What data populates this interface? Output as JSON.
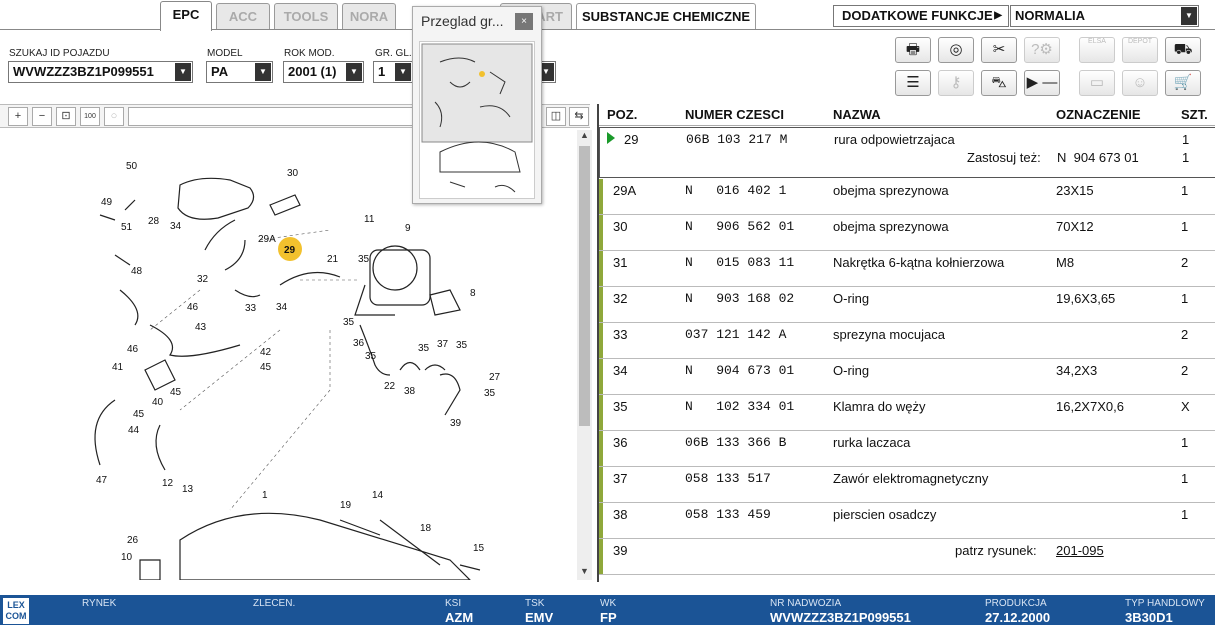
{
  "tabs": [
    {
      "label": "EPC",
      "state": "active"
    },
    {
      "label": "ACC",
      "state": "disabled"
    },
    {
      "label": "TOOLS",
      "state": "disabled"
    },
    {
      "label": "NORA",
      "state": "disabled"
    },
    {
      "label": "ART",
      "state": "disabled"
    },
    {
      "label": "SUBSTANCJE CHEMICZNE",
      "state": "enabled"
    }
  ],
  "functions": {
    "label": "DODATKOWE FUNKCJE",
    "arrow": "▶",
    "selected": "NORMALIA"
  },
  "vehicle": {
    "vin_label": "SZUKAJ ID POJAZDU",
    "vin_value": "WVWZZZ3BZ1P099551",
    "model_label": "MODEL",
    "model_value": "PA",
    "year_label": "ROK MOD.",
    "year_value": "2001 (1)",
    "group_label": "GR. GL.",
    "group_value": "1"
  },
  "overview": {
    "title": "Przeglad gr...",
    "close": "×"
  },
  "toolbar_icons": [
    {
      "name": "print-icon",
      "glyph": "🖶",
      "disabled": false
    },
    {
      "name": "settings-disc-icon",
      "glyph": "◎",
      "disabled": false
    },
    {
      "name": "tools-icon",
      "glyph": "✂",
      "disabled": false
    },
    {
      "name": "search-parts-icon",
      "glyph": "?⚙",
      "disabled": true
    },
    {
      "name": "elsa-icon",
      "glyph": "▭",
      "caption": "ELSA",
      "disabled": true
    },
    {
      "name": "depot-icon",
      "glyph": "▭",
      "caption": "DEPOT",
      "disabled": true
    },
    {
      "name": "cart-transfer-icon",
      "glyph": "⛟",
      "disabled": false
    },
    {
      "name": "list-icon",
      "glyph": "☰",
      "disabled": false
    },
    {
      "name": "key-icon",
      "glyph": "⚷",
      "disabled": true
    },
    {
      "name": "vehicle-lift-icon",
      "glyph": "⛍",
      "disabled": false
    },
    {
      "name": "play-minus-icon",
      "glyph": "▶ —",
      "disabled": false
    },
    {
      "name": "copy-icon",
      "glyph": "▭",
      "disabled": true
    },
    {
      "name": "user-icon",
      "glyph": "☺",
      "disabled": true
    },
    {
      "name": "cart-icon",
      "glyph": "🛒",
      "disabled": false
    }
  ],
  "zoom": [
    {
      "name": "zoom-in-icon",
      "glyph": "+"
    },
    {
      "name": "zoom-out-icon",
      "glyph": "−"
    },
    {
      "name": "zoom-fit-icon",
      "glyph": "⊡"
    },
    {
      "name": "zoom-100-icon",
      "glyph": "100"
    },
    {
      "name": "zoom-area-icon",
      "glyph": "○"
    }
  ],
  "columns": {
    "pos": "POZ.",
    "part": "NUMER CZESCI",
    "name": "NAZWA",
    "code": "OZNACZENIE",
    "qty": "SZT."
  },
  "rows": [
    {
      "pos": "29",
      "part": "06B 103 217 M",
      "name": "rura odpowietrzajaca",
      "code": "",
      "qty": "1",
      "selected": true,
      "note_label": "Zastosuj też:",
      "note_part": "N  904 673 01",
      "note_qty": "1"
    },
    {
      "pos": "29A",
      "part": "N   016 402 1",
      "name": "obejma sprezynowa",
      "code": "23X15",
      "qty": "1"
    },
    {
      "pos": "30",
      "part": "N   906 562 01",
      "name": "obejma sprezynowa",
      "code": "70X12",
      "qty": "1"
    },
    {
      "pos": "31",
      "part": "N   015 083 11",
      "name": "Nakrętka 6-kątna kołnierzowa",
      "code": "M8",
      "qty": "2"
    },
    {
      "pos": "32",
      "part": "N   903 168 02",
      "name": "O-ring",
      "code": "19,6X3,65",
      "qty": "1"
    },
    {
      "pos": "33",
      "part": "037 121 142 A",
      "name": "sprezyna mocujaca",
      "code": "",
      "qty": "2"
    },
    {
      "pos": "34",
      "part": "N   904 673 01",
      "name": "O-ring",
      "code": "34,2X3",
      "qty": "2"
    },
    {
      "pos": "35",
      "part": "N   102 334 01",
      "name": "Klamra do węży",
      "code": "16,2X7X0,6",
      "qty": "X"
    },
    {
      "pos": "36",
      "part": "06B 133 366 B",
      "name": "rurka laczaca",
      "code": "",
      "qty": "1"
    },
    {
      "pos": "37",
      "part": "058 133 517",
      "name": "Zawór elektromagnetyczny",
      "code": "",
      "qty": "1"
    },
    {
      "pos": "38",
      "part": "058 133 459",
      "name": "pierscien osadczy",
      "code": "",
      "qty": "1"
    },
    {
      "pos": "39",
      "part": "",
      "name": "",
      "code": "",
      "qty": "",
      "ref_label": "patrz rysunek:",
      "ref_value": "201-095"
    }
  ],
  "drawing_labels": [
    "50",
    "49",
    "51",
    "48",
    "46",
    "43",
    "46",
    "41",
    "40",
    "45",
    "45",
    "44",
    "47",
    "42",
    "45",
    "12",
    "13",
    "26",
    "10",
    "34",
    "28",
    "32",
    "33",
    "34",
    "29A",
    "29",
    "30",
    "21",
    "35",
    "11",
    "9",
    "8",
    "35",
    "36",
    "35",
    "35",
    "37",
    "35",
    "22",
    "38",
    "27",
    "35",
    "39",
    "19",
    "14",
    "18",
    "15",
    "1"
  ],
  "status": {
    "logo": "LEX COM",
    "items": [
      {
        "label": "RYNEK",
        "value": ""
      },
      {
        "label": "ZLECEN.",
        "value": ""
      },
      {
        "label": "KSI",
        "value": "AZM"
      },
      {
        "label": "TSK",
        "value": "EMV"
      },
      {
        "label": "WK",
        "value": "FP"
      },
      {
        "label": "NR NADWOZIA",
        "value": "WVWZZZ3BZ1P099551"
      },
      {
        "label": "PRODUKCJA",
        "value": "27.12.2000"
      },
      {
        "label": "TYP HANDLOWY",
        "value": "3B30D1"
      }
    ]
  },
  "colors": {
    "status_bar": "#1b5496",
    "row_marker": "#8fa83b",
    "highlight": "#f2c12e",
    "play": "#1a9a2a"
  }
}
